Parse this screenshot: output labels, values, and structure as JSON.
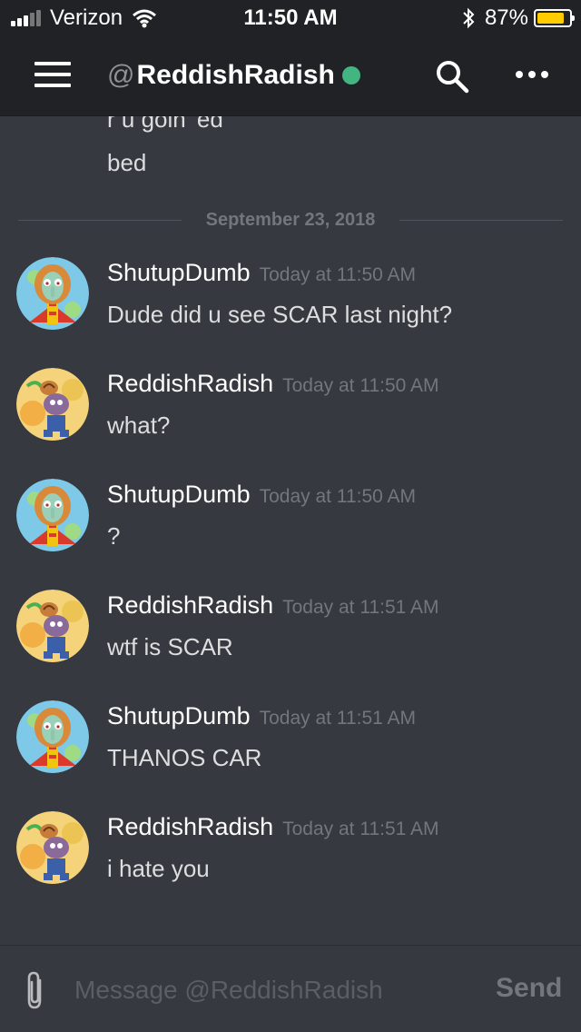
{
  "status_bar": {
    "carrier": "Verizon",
    "time": "11:50 AM",
    "battery_percent": "87%",
    "battery_level": 0.87,
    "icons": [
      "signal-icon",
      "wifi-icon",
      "bluetooth-icon",
      "battery-icon"
    ]
  },
  "header": {
    "at_symbol": "@",
    "channel_name": "ReddishRadish",
    "status": "online",
    "status_color": "#43b581"
  },
  "conversation": {
    "partial_previous": "r u goin' ed",
    "previous_message": "bed",
    "date_divider": "September 23, 2018",
    "messages": [
      {
        "author": "ShutupDumb",
        "timestamp": "Today at 11:50 AM",
        "text": "Dude did u see SCAR last night?"
      },
      {
        "author": "ReddishRadish",
        "timestamp": "Today at 11:50 AM",
        "text": "what?"
      },
      {
        "author": "ShutupDumb",
        "timestamp": "Today at 11:50 AM",
        "text": "?"
      },
      {
        "author": "ReddishRadish",
        "timestamp": "Today at 11:51 AM",
        "text": "wtf is SCAR"
      },
      {
        "author": "ShutupDumb",
        "timestamp": "Today at 11:51 AM",
        "text": "THANOS CAR"
      },
      {
        "author": "ReddishRadish",
        "timestamp": "Today at 11:51 AM",
        "text": "i hate you"
      }
    ]
  },
  "composer": {
    "placeholder": "Message @ReddishRadish",
    "send_label": "Send"
  },
  "colors": {
    "background": "#36393f",
    "header": "#202225",
    "accent_online": "#43b581",
    "battery": "#ffcc00"
  }
}
